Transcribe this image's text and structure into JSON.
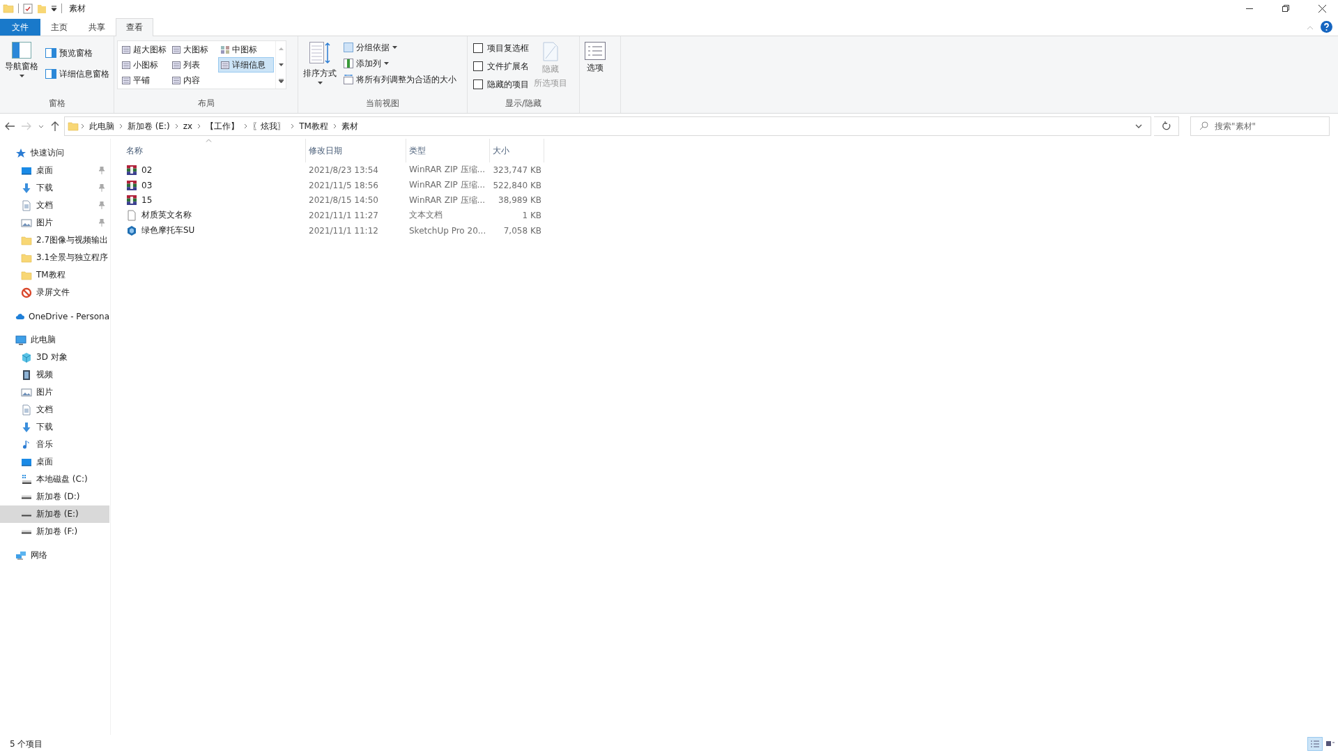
{
  "window": {
    "title": "素材"
  },
  "ribbon_tabs": [
    {
      "label": "文件",
      "kind": "file",
      "selected": false
    },
    {
      "label": "主页",
      "kind": "tab",
      "selected": false
    },
    {
      "label": "共享",
      "kind": "tab",
      "selected": false
    },
    {
      "label": "查看",
      "kind": "tab",
      "selected": true
    }
  ],
  "ribbon": {
    "panes": {
      "label": "窗格",
      "navigation_pane": "导航窗格",
      "preview_pane": "预览窗格",
      "details_pane": "详细信息窗格"
    },
    "layout": {
      "label": "布局",
      "items": [
        {
          "label": "超大图标",
          "selected": false
        },
        {
          "label": "大图标",
          "selected": false
        },
        {
          "label": "中图标",
          "selected": false
        },
        {
          "label": "小图标",
          "selected": false
        },
        {
          "label": "列表",
          "selected": false
        },
        {
          "label": "详细信息",
          "selected": true
        },
        {
          "label": "平铺",
          "selected": false
        },
        {
          "label": "内容",
          "selected": false
        }
      ]
    },
    "current_view": {
      "label": "当前视图",
      "sort_by": "排序方式",
      "group_by": "分组依据",
      "add_columns": "添加列",
      "size_all_columns": "将所有列调整为合适的大小"
    },
    "show_hide": {
      "label": "显示/隐藏",
      "checkboxes": [
        {
          "label": "项目复选框",
          "checked": false
        },
        {
          "label": "文件扩展名",
          "checked": false
        },
        {
          "label": "隐藏的项目",
          "checked": false
        }
      ],
      "hide_selected": {
        "lines": [
          "隐藏",
          "所选项目"
        ],
        "disabled": true
      }
    },
    "options": {
      "label": "选项"
    }
  },
  "address_bar": {
    "path": [
      "此电脑",
      "新加卷 (E:)",
      "zx",
      "【工作】",
      "〖炫我〗",
      "TM教程",
      "素材"
    ]
  },
  "search": {
    "placeholder": "搜索\"素材\""
  },
  "navigation": [
    {
      "label": "快速访问",
      "kind": "star",
      "selected": false,
      "children": [
        {
          "label": "桌面",
          "kind": "desktop",
          "pinned": true,
          "selected": false
        },
        {
          "label": "下载",
          "kind": "download",
          "pinned": true,
          "selected": false
        },
        {
          "label": "文档",
          "kind": "document",
          "pinned": true,
          "selected": false
        },
        {
          "label": "图片",
          "kind": "picture",
          "pinned": true,
          "selected": false
        },
        {
          "label": "2.7图像与视频输出",
          "kind": "folder",
          "pinned": false,
          "selected": false
        },
        {
          "label": "3.1全景与独立程序",
          "kind": "folder",
          "pinned": false,
          "selected": false
        },
        {
          "label": "TM教程",
          "kind": "folder",
          "pinned": false,
          "selected": false
        },
        {
          "label": "录屏文件",
          "kind": "blocked",
          "pinned": false,
          "selected": false
        }
      ]
    },
    {
      "label": "OneDrive - Persona",
      "kind": "cloud",
      "selected": false
    },
    {
      "label": "此电脑",
      "kind": "computer",
      "selected": false,
      "children": [
        {
          "label": "3D 对象",
          "kind": "cube",
          "selected": false
        },
        {
          "label": "视频",
          "kind": "video",
          "selected": false
        },
        {
          "label": "图片",
          "kind": "picture",
          "selected": false
        },
        {
          "label": "文档",
          "kind": "document",
          "selected": false
        },
        {
          "label": "下载",
          "kind": "download",
          "selected": false
        },
        {
          "label": "音乐",
          "kind": "music",
          "selected": false
        },
        {
          "label": "桌面",
          "kind": "desktop",
          "selected": false
        },
        {
          "label": "本地磁盘 (C:)",
          "kind": "system_drive",
          "selected": false
        },
        {
          "label": "新加卷 (D:)",
          "kind": "drive",
          "selected": false
        },
        {
          "label": "新加卷 (E:)",
          "kind": "drive",
          "selected": true
        },
        {
          "label": "新加卷 (F:)",
          "kind": "drive",
          "selected": false
        }
      ]
    },
    {
      "label": "网络",
      "kind": "network",
      "selected": false
    }
  ],
  "table": {
    "columns": [
      {
        "label": "名称",
        "sorted": true
      },
      {
        "label": "修改日期",
        "sorted": false
      },
      {
        "label": "类型",
        "sorted": false
      },
      {
        "label": "大小",
        "sorted": false
      }
    ],
    "rows": [
      {
        "name": "02",
        "kind": "zip",
        "modified": "2021/8/23 13:54",
        "type": "WinRAR ZIP 压缩...",
        "size": "323,747 KB"
      },
      {
        "name": "03",
        "kind": "zip",
        "modified": "2021/11/5 18:56",
        "type": "WinRAR ZIP 压缩...",
        "size": "522,840 KB"
      },
      {
        "name": "15",
        "kind": "zip",
        "modified": "2021/8/15 14:50",
        "type": "WinRAR ZIP 压缩...",
        "size": "38,989 KB"
      },
      {
        "name": "材质英文名称",
        "kind": "text",
        "modified": "2021/11/1 11:27",
        "type": "文本文档",
        "size": "1 KB"
      },
      {
        "name": "绿色摩托车SU",
        "kind": "sketchup",
        "modified": "2021/11/1 11:12",
        "type": "SketchUp Pro 20...",
        "size": "7,058 KB"
      }
    ]
  },
  "status_bar": {
    "item_count": "5 个项目",
    "views": [
      {
        "kind": "details",
        "selected": true
      },
      {
        "kind": "large_icons",
        "selected": false
      }
    ]
  }
}
